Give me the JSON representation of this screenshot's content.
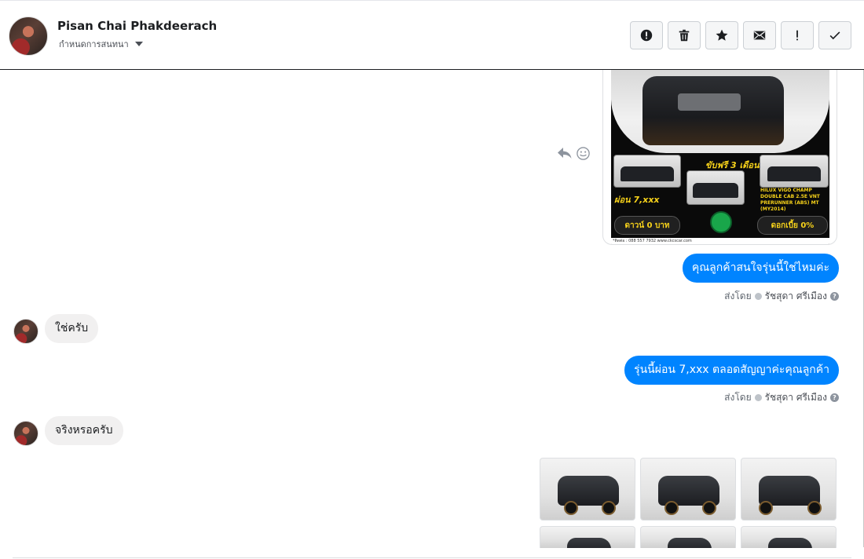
{
  "header": {
    "contact_name": "Pisan Chai Phakdeerach",
    "assign_label": "กำหนดการสนทนา",
    "actions": [
      {
        "name": "report-spam-icon"
      },
      {
        "name": "trash-icon"
      },
      {
        "name": "star-icon"
      },
      {
        "name": "envelope-icon"
      },
      {
        "name": "exclamation-icon"
      },
      {
        "name": "checkmark-icon"
      }
    ]
  },
  "ad": {
    "tagline": "ขับฟรี 3 เดือน",
    "installment": "ผ่อน 7,xxx",
    "model": "HILUX VIGO CHAMP DOUBLE CAB 2.5E VNT PRERUNNER (ABS) MT (MY2014)",
    "down_payment": "ดาวน์ 0 บาท",
    "interest": "ดอกเบี้ย 0%",
    "footer": "*ติดต่อ : 088 557 7932   www.ckcscar.com"
  },
  "messages": [
    {
      "direction": "out",
      "text": "คุณลูกค้าสนใจรุ่นนี้ใช่ไหมค่ะ"
    },
    {
      "direction": "in",
      "text": "ใช่ครับ"
    },
    {
      "direction": "out",
      "text": "รุ่นนี้ผ่อน 7,xxx ตลอดสัญญาค่ะคุณลูกค้า"
    },
    {
      "direction": "in",
      "text": "จริงหรอครับ"
    }
  ],
  "sent_by": {
    "prefix": "ส่งโดย",
    "agent": "รัชสุดา ศรีเมือง",
    "help": "?"
  },
  "colors": {
    "outgoing_bubble": "#0084ff",
    "incoming_bubble": "#f1f0f0",
    "ad_accent": "#f7d21a"
  }
}
